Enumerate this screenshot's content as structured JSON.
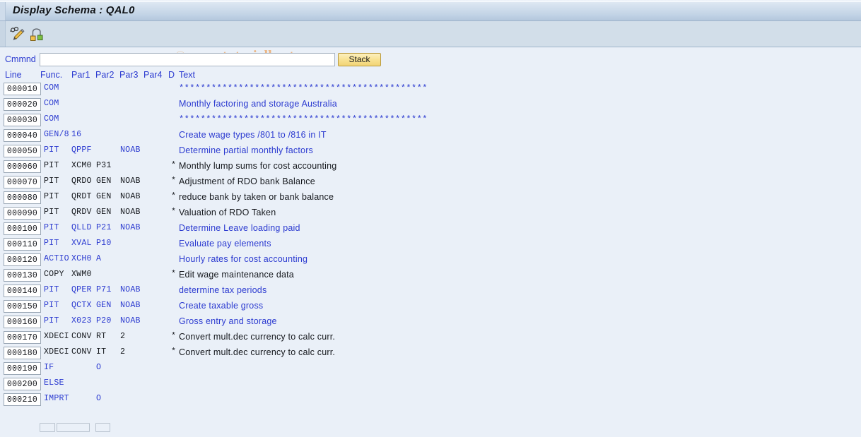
{
  "window": {
    "title": "Display Schema : QAL0"
  },
  "toolbar": {
    "icons": [
      {
        "name": "display-change-pencil-icon",
        "tooltip": "Display <-> Change"
      },
      {
        "name": "structure-hierarchy-icon",
        "tooltip": "Structural Graphics"
      }
    ]
  },
  "watermark": {
    "copyright_symbol": "©",
    "text": " www.tutorialkart.com",
    "color": "#eab584"
  },
  "command": {
    "label": "Cmmnd",
    "value": "",
    "placeholder": "",
    "stack_label": "Stack"
  },
  "grid": {
    "headers": {
      "line": "Line",
      "func": "Func.",
      "par1": "Par1",
      "par2": "Par2",
      "par3": "Par3",
      "par4": "Par4",
      "d": "D",
      "text": "Text"
    },
    "stars": "**********************************************",
    "colors": {
      "blue_row": "#2b3ad0",
      "dark_row": "#15181d",
      "label": "#2b3ad0"
    },
    "rows": [
      {
        "line": "000010",
        "func": "COM",
        "par1": "",
        "par2": "",
        "par3": "",
        "par4": "",
        "d": "",
        "text": "**********************************************",
        "is_stars": true,
        "style": "blue"
      },
      {
        "line": "000020",
        "func": "COM",
        "par1": "",
        "par2": "",
        "par3": "",
        "par4": "",
        "d": "",
        "text": "Monthly factoring and storage Australia",
        "is_stars": false,
        "style": "blue"
      },
      {
        "line": "000030",
        "func": "COM",
        "par1": "",
        "par2": "",
        "par3": "",
        "par4": "",
        "d": "",
        "text": "**********************************************",
        "is_stars": true,
        "style": "blue"
      },
      {
        "line": "000040",
        "func": "GEN/8",
        "par1": "16",
        "par2": "",
        "par3": "",
        "par4": "",
        "d": "",
        "text": "Create wage types /801 to /816 in IT",
        "is_stars": false,
        "style": "blue"
      },
      {
        "line": "000050",
        "func": "PIT",
        "par1": "QPPF",
        "par2": "",
        "par3": "NOAB",
        "par4": "",
        "d": "",
        "text": "Determine partial monthly factors",
        "is_stars": false,
        "style": "blue"
      },
      {
        "line": "000060",
        "func": "PIT",
        "par1": "XCM0",
        "par2": "P31",
        "par3": "",
        "par4": "",
        "d": "*",
        "text": "Monthly lump sums for cost accounting",
        "is_stars": false,
        "style": "dark"
      },
      {
        "line": "000070",
        "func": "PIT",
        "par1": "QRDO",
        "par2": "GEN",
        "par3": "NOAB",
        "par4": "",
        "d": "*",
        "text": "Adjustment of RDO bank Balance",
        "is_stars": false,
        "style": "dark"
      },
      {
        "line": "000080",
        "func": "PIT",
        "par1": "QRDT",
        "par2": "GEN",
        "par3": "NOAB",
        "par4": "",
        "d": "*",
        "text": "reduce bank by taken or bank balance",
        "is_stars": false,
        "style": "dark"
      },
      {
        "line": "000090",
        "func": "PIT",
        "par1": "QRDV",
        "par2": "GEN",
        "par3": "NOAB",
        "par4": "",
        "d": "*",
        "text": "Valuation of RDO Taken",
        "is_stars": false,
        "style": "dark"
      },
      {
        "line": "000100",
        "func": "PIT",
        "par1": "QLLD",
        "par2": "P21",
        "par3": "NOAB",
        "par4": "",
        "d": "",
        "text": "Determine Leave loading paid",
        "is_stars": false,
        "style": "blue"
      },
      {
        "line": "000110",
        "func": "PIT",
        "par1": "XVAL",
        "par2": "P10",
        "par3": "",
        "par4": "",
        "d": "",
        "text": "Evaluate pay elements",
        "is_stars": false,
        "style": "blue"
      },
      {
        "line": "000120",
        "func": "ACTIO",
        "par1": "XCH0",
        "par2": "A",
        "par3": "",
        "par4": "",
        "d": "",
        "text": "Hourly rates for cost accounting",
        "is_stars": false,
        "style": "blue"
      },
      {
        "line": "000130",
        "func": "COPY",
        "par1": "XWM0",
        "par2": "",
        "par3": "",
        "par4": "",
        "d": "*",
        "text": "Edit wage maintenance data",
        "is_stars": false,
        "style": "dark"
      },
      {
        "line": "000140",
        "func": "PIT",
        "par1": "QPER",
        "par2": "P71",
        "par3": "NOAB",
        "par4": "",
        "d": "",
        "text": "determine tax periods",
        "is_stars": false,
        "style": "blue"
      },
      {
        "line": "000150",
        "func": "PIT",
        "par1": "QCTX",
        "par2": "GEN",
        "par3": "NOAB",
        "par4": "",
        "d": "",
        "text": "Create taxable gross",
        "is_stars": false,
        "style": "blue"
      },
      {
        "line": "000160",
        "func": "PIT",
        "par1": "X023",
        "par2": "P20",
        "par3": "NOAB",
        "par4": "",
        "d": "",
        "text": "Gross entry and storage",
        "is_stars": false,
        "style": "blue"
      },
      {
        "line": "000170",
        "func": "XDECI",
        "par1": "CONV",
        "par2": "RT",
        "par3": "2",
        "par4": "",
        "d": "*",
        "text": "Convert mult.dec currency to calc curr.",
        "is_stars": false,
        "style": "dark"
      },
      {
        "line": "000180",
        "func": "XDECI",
        "par1": "CONV",
        "par2": "IT",
        "par3": "2",
        "par4": "",
        "d": "*",
        "text": "Convert mult.dec currency to calc curr.",
        "is_stars": false,
        "style": "dark"
      },
      {
        "line": "000190",
        "func": "IF",
        "par1": "",
        "par2": "O",
        "par3": "",
        "par4": "",
        "d": "",
        "text": "",
        "is_stars": false,
        "style": "blue"
      },
      {
        "line": "000200",
        "func": "ELSE",
        "par1": "",
        "par2": "",
        "par3": "",
        "par4": "",
        "d": "",
        "text": "",
        "is_stars": false,
        "style": "blue"
      },
      {
        "line": "000210",
        "func": "IMPRT",
        "par1": "",
        "par2": "O",
        "par3": "",
        "par4": "",
        "d": "",
        "text": "",
        "is_stars": false,
        "style": "blue"
      }
    ]
  },
  "hscroll": {
    "left_arrow": "",
    "thumb": "",
    "right_arrow": ""
  }
}
